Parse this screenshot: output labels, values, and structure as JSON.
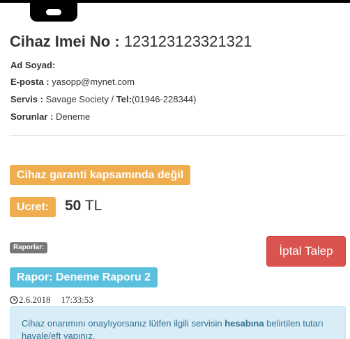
{
  "device": {
    "title_label": "Cihaz Imei No :",
    "imei": "123123123321321",
    "owner_label": "Ad Soyad:",
    "owner_value": "",
    "email_label": "E-posta :",
    "email_value": "yasopp@mynet.com",
    "service_label": "Servis :",
    "service_value": "Savage Society /",
    "tel_label": "Tel:",
    "tel_value": "(01946-228344)",
    "issues_label": "Sorunlar :",
    "issues_value": "Deneme"
  },
  "status": {
    "warranty_text": "Cihaz garanti kapsamında değil",
    "fee_label": "Ucret:",
    "fee_amount": "50",
    "fee_currency": "TL"
  },
  "reports": {
    "section_label": "Raporlar:",
    "cancel_label": "İptal Talep",
    "report_title": "Rapor: Deneme Raporu 2",
    "date": "2.6.2018",
    "time": "17:33:53",
    "alert_text_before": "Cihaz onarımını onaylıyorsanız lütfen ilgili servisin",
    "alert_text_bold": "hesabına",
    "alert_text_after": "belirtilen tutarı havale/eft yapınız."
  },
  "colors": {
    "warning": "#f0ad4e",
    "danger": "#d9534f",
    "info": "#5bc0de",
    "alert_bg": "#d9edf7",
    "alert_text": "#31708f"
  },
  "icons": {
    "device": "mobile-phone-icon",
    "clock": "clock-icon"
  }
}
